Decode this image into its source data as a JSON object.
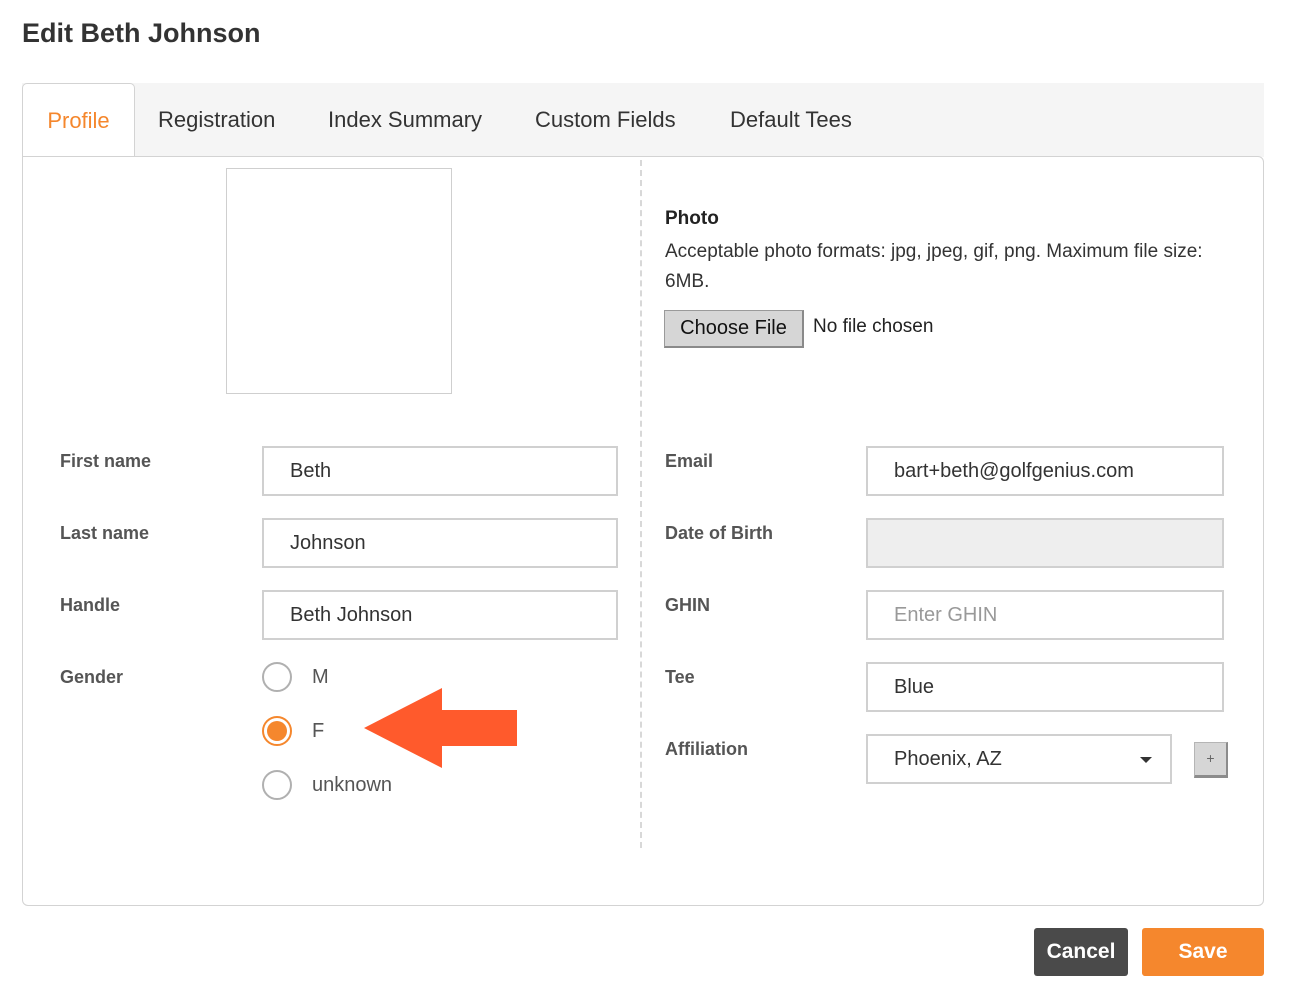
{
  "page": {
    "title": "Edit Beth Johnson"
  },
  "tabs": [
    {
      "label": "Profile",
      "active": true
    },
    {
      "label": "Registration",
      "active": false
    },
    {
      "label": "Index Summary",
      "active": false
    },
    {
      "label": "Custom Fields",
      "active": false
    },
    {
      "label": "Default Tees",
      "active": false
    }
  ],
  "photo": {
    "title": "Photo",
    "help": "Acceptable photo formats: jpg, jpeg, gif, png. Maximum file size: 6MB.",
    "choose_label": "Choose File",
    "status": "No file chosen"
  },
  "left_form": {
    "first_name": {
      "label": "First name",
      "value": "Beth"
    },
    "last_name": {
      "label": "Last name",
      "value": "Johnson"
    },
    "handle": {
      "label": "Handle",
      "value": "Beth Johnson"
    },
    "gender": {
      "label": "Gender",
      "options": [
        "M",
        "F",
        "unknown"
      ],
      "selected": "F"
    }
  },
  "right_form": {
    "email": {
      "label": "Email",
      "value": "bart+beth@golfgenius.com"
    },
    "dob": {
      "label": "Date of Birth",
      "value": ""
    },
    "ghin": {
      "label": "GHIN",
      "value": "",
      "placeholder": "Enter GHIN"
    },
    "tee": {
      "label": "Tee",
      "value": "Blue"
    },
    "affiliation": {
      "label": "Affiliation",
      "value": "Phoenix, AZ",
      "add_label": "+"
    }
  },
  "actions": {
    "cancel_label": "Cancel",
    "save_label": "Save"
  },
  "colors": {
    "accent": "#f5872d",
    "arrow": "#ff5a2c",
    "cancel_bg": "#4a4a4a"
  },
  "icons": {
    "select_caret": "chevron-down-icon",
    "annotation": "arrow-left-icon"
  }
}
